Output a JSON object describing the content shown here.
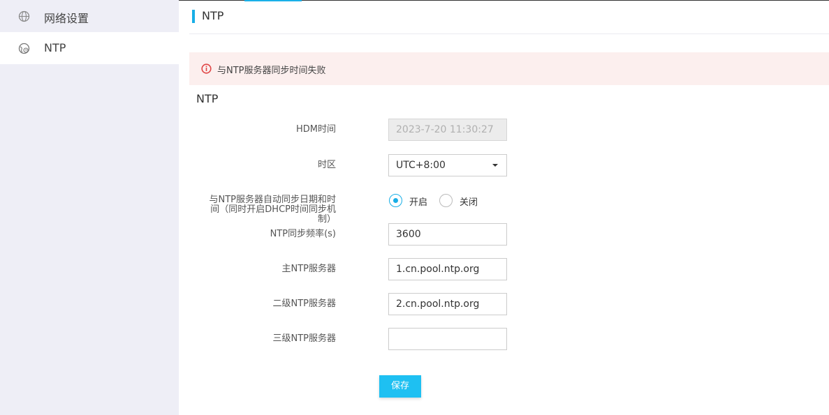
{
  "sidebar": {
    "items": [
      {
        "label": "网络设置",
        "icon": "globe-icon"
      },
      {
        "label": "NTP",
        "icon": "clock-globe-icon"
      }
    ]
  },
  "header": {
    "title": "NTP"
  },
  "alert": {
    "message": "与NTP服务器同步时间失败",
    "color": "#e04545"
  },
  "section": {
    "title": "NTP"
  },
  "form": {
    "hdm_time": {
      "label": "HDM时间",
      "value": "2023-7-20 11:30:27"
    },
    "timezone": {
      "label": "时区",
      "value": "UTC+8:00"
    },
    "auto_sync": {
      "label_lines": [
        "与NTP服务器自动同步日期和时",
        "间（同时开启DHCP时间同步机",
        "制）"
      ],
      "options": [
        "开启",
        "关闭"
      ],
      "selected": "开启"
    },
    "sync_freq": {
      "label": "NTP同步频率(s)",
      "value": "3600"
    },
    "primary": {
      "label": "主NTP服务器",
      "value": "1.cn.pool.ntp.org"
    },
    "secondary": {
      "label": "二级NTP服务器",
      "value": "2.cn.pool.ntp.org"
    },
    "tertiary": {
      "label": "三级NTP服务器",
      "value": ""
    }
  },
  "buttons": {
    "save": "保存"
  },
  "colors": {
    "accent": "#18aee6",
    "save_button": "#1ec0f2",
    "alert_bg": "#fcefee"
  }
}
